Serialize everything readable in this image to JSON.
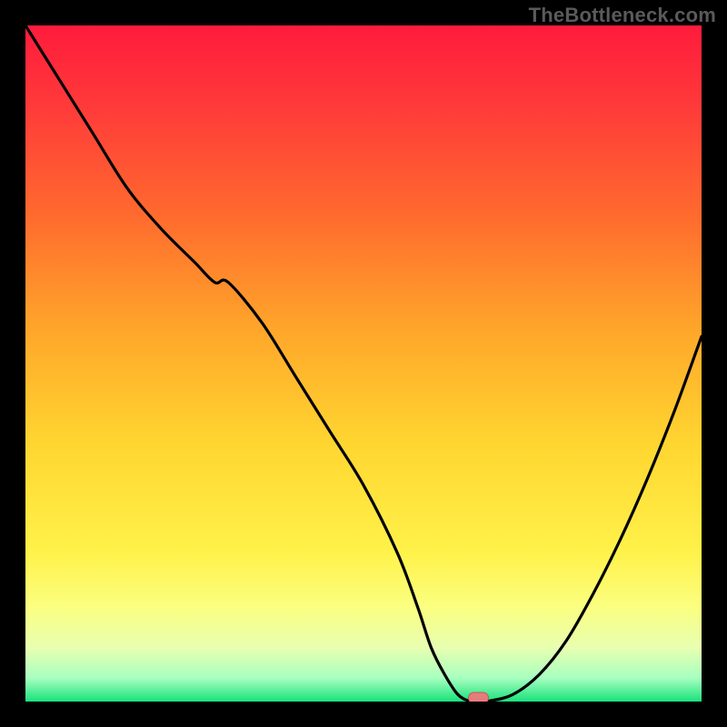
{
  "watermark": "TheBottleneck.com",
  "colors": {
    "bg": "#000000",
    "curve": "#000000",
    "marker_fill": "#e77c7c",
    "marker_stroke": "#c05858",
    "gradient_stops": [
      {
        "offset": 0.0,
        "color": "#ff1b3c"
      },
      {
        "offset": 0.12,
        "color": "#ff3a3a"
      },
      {
        "offset": 0.28,
        "color": "#ff6a2e"
      },
      {
        "offset": 0.45,
        "color": "#ffa62a"
      },
      {
        "offset": 0.62,
        "color": "#ffd630"
      },
      {
        "offset": 0.78,
        "color": "#fff24a"
      },
      {
        "offset": 0.86,
        "color": "#fbff80"
      },
      {
        "offset": 0.92,
        "color": "#e8ffb0"
      },
      {
        "offset": 0.965,
        "color": "#a8ffc0"
      },
      {
        "offset": 1.0,
        "color": "#18e27a"
      }
    ]
  },
  "chart_data": {
    "type": "line",
    "title": "",
    "xlabel": "",
    "ylabel": "",
    "xlim": [
      0,
      100
    ],
    "ylim": [
      0,
      100
    ],
    "legend": false,
    "grid": false,
    "series": [
      {
        "name": "bottleneck-curve",
        "x": [
          0,
          5,
          10,
          15,
          20,
          25,
          28,
          30,
          35,
          40,
          45,
          50,
          55,
          58,
          60,
          62,
          64,
          66,
          68,
          72,
          76,
          80,
          84,
          88,
          92,
          96,
          100
        ],
        "y": [
          100,
          92,
          84,
          76,
          70,
          65,
          62,
          62,
          56,
          48,
          40,
          32,
          22,
          14,
          8,
          4,
          1,
          0,
          0,
          1,
          4,
          9,
          16,
          24,
          33,
          43,
          54
        ]
      }
    ],
    "marker": {
      "x": 67,
      "y": 0,
      "shape": "pill"
    },
    "notes": "x and y are in percent of plot width/height; y=0 is bottom (green), y=100 is top (red)."
  }
}
